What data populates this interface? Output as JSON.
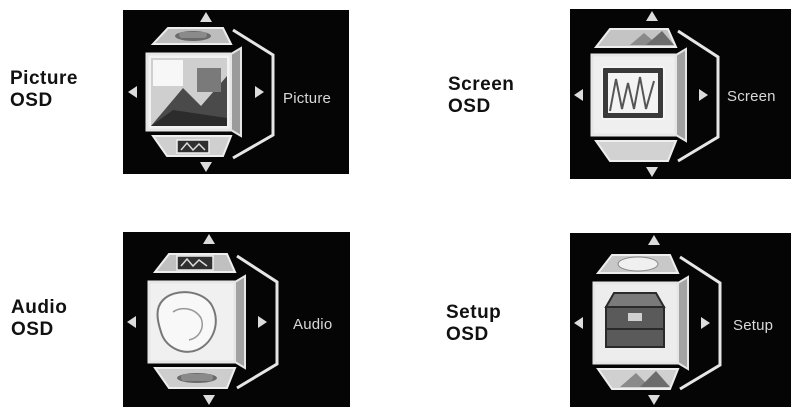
{
  "panels": [
    {
      "label_line1": "Picture",
      "label_line2": "OSD",
      "menu_text": "Picture",
      "front_icon": "picture-landscape-icon",
      "top_icon": "gamepad-icon",
      "bottom_icon": "monitor-icon"
    },
    {
      "label_line1": "Screen",
      "label_line2": "OSD",
      "menu_text": "Screen",
      "front_icon": "monitor-screen-icon",
      "top_icon": "landscape-icon",
      "bottom_icon": ""
    },
    {
      "label_line1": "Audio",
      "label_line2": "OSD",
      "menu_text": "Audio",
      "front_icon": "audio-shell-icon",
      "top_icon": "monitor-icon",
      "bottom_icon": "gamepad-icon"
    },
    {
      "label_line1": "Setup",
      "label_line2": "OSD",
      "menu_text": "Setup",
      "front_icon": "toolbox-icon",
      "top_icon": "shell-icon",
      "bottom_icon": "landscape-icon"
    }
  ],
  "colors": {
    "screen_background": "#050505",
    "menu_text": "#d8d8d8",
    "cube_frame": "#e6e6e6"
  }
}
